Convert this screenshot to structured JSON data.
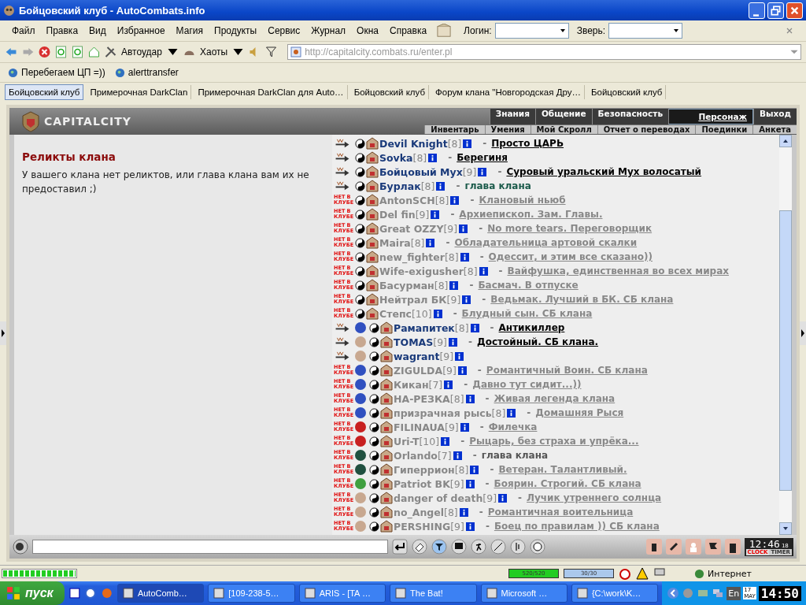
{
  "window": {
    "title": "Бойцовский клуб - AutoCombats.info"
  },
  "menu": [
    "Файл",
    "Правка",
    "Вид",
    "Избранное",
    "Магия",
    "Продукты",
    "Сервис",
    "Журнал",
    "Окна",
    "Справка"
  ],
  "login": {
    "label": "Логин:"
  },
  "pet": {
    "label": "Зверь:"
  },
  "toolbar": {
    "autohit": "Автоудар",
    "chaos": "Хаоты",
    "address": "http://capitalcity.combats.ru/enter.pl"
  },
  "links": [
    "Перебегаем ЦП =))",
    "alerttransfer"
  ],
  "tabs": [
    {
      "label": "Бойцовский клуб",
      "selected": true
    },
    {
      "label": "Примерочная DarkClan",
      "selected": false
    },
    {
      "label": "Примерочная DarkClan для Auto…",
      "selected": false
    },
    {
      "label": "Бойцовский клуб",
      "selected": false
    },
    {
      "label": "Форум клана \"Новгородская Дру…",
      "selected": false
    },
    {
      "label": "Бойцовский клуб",
      "selected": false
    }
  ],
  "game": {
    "logo": "CAPITALCITY",
    "nav_top": [
      {
        "label": "Знания",
        "selected": false
      },
      {
        "label": "Общение",
        "selected": false
      },
      {
        "label": "Безопасность",
        "selected": false
      },
      {
        "label": "Персонаж",
        "selected": true
      },
      {
        "label": "Выход",
        "selected": false
      }
    ],
    "nav_bottom": [
      "Инвентарь",
      "Умения",
      "Мой Скролл",
      "Отчет о переводах",
      "Поединки",
      "Анкета"
    ],
    "relics_heading": "Реликты клана",
    "relics_text": "У вашего клана нет реликтов, или глава клана вам их не предоставил ;)",
    "separator": "-",
    "members": [
      {
        "kind": "in_club",
        "name": "Devil Knight",
        "rank": "[8]",
        "online": true,
        "title": {
          "kind": "link",
          "text": "Просто ЦАРЬ"
        }
      },
      {
        "kind": "in_club",
        "name": "Sovka",
        "rank": "[8]",
        "online": true,
        "title": {
          "kind": "link",
          "text": "Берегиня"
        }
      },
      {
        "kind": "in_club",
        "name": "Бойцовый Мух",
        "rank": "[9]",
        "online": true,
        "title": {
          "kind": "link",
          "text": "Суровый уральский Мух волосатый"
        }
      },
      {
        "kind": "in_club",
        "name": "Бурлак",
        "rank": "[8]",
        "online": true,
        "title": {
          "kind": "plain",
          "text": "глава клана"
        }
      },
      {
        "kind": "not_in_club",
        "badge": "НЕТ В КЛУБЕ",
        "name": "AntonSCH",
        "rank": "[8]",
        "online": false,
        "title": {
          "kind": "link",
          "text": "Клановый ньюб"
        }
      },
      {
        "kind": "not_in_club",
        "badge": "НЕТ В КЛУБЕ",
        "name": "Del fin",
        "rank": "[9]",
        "online": false,
        "title": {
          "kind": "link",
          "text": "Архиепископ. Зам. Главы."
        }
      },
      {
        "kind": "not_in_club",
        "badge": "НЕТ В КЛУБЕ",
        "name": "Great OZZY",
        "rank": "[9]",
        "online": false,
        "title": {
          "kind": "link",
          "text": "No more tears. Переговорщик"
        }
      },
      {
        "kind": "not_in_club",
        "badge": "НЕТ В КЛУБЕ",
        "name": "Maira",
        "rank": "[8]",
        "online": false,
        "title": {
          "kind": "link",
          "text": "Обладательница артовой скалки"
        }
      },
      {
        "kind": "not_in_club",
        "badge": "НЕТ В КЛУБЕ",
        "name": "new_fighter",
        "rank": "[8]",
        "online": false,
        "title": {
          "kind": "link",
          "text": "Одессит, и этим все сказано))"
        }
      },
      {
        "kind": "not_in_club",
        "badge": "НЕТ В КЛУБЕ",
        "name": "Wife-exigusher",
        "rank": "[8]",
        "online": false,
        "title": {
          "kind": "link",
          "text": "Вайфушка, единственная во всех мирах"
        }
      },
      {
        "kind": "not_in_club",
        "badge": "НЕТ В КЛУБЕ",
        "name": "Басурман",
        "rank": "[8]",
        "online": false,
        "title": {
          "kind": "link",
          "text": "Басмач. В отпуске"
        }
      },
      {
        "kind": "not_in_club",
        "badge": "НЕТ В КЛУБЕ",
        "name": "Нейтрал БК",
        "rank": "[9]",
        "online": false,
        "title": {
          "kind": "link",
          "text": "Ведьмак. Лучший в БК. СБ клана"
        }
      },
      {
        "kind": "not_in_club",
        "badge": "НЕТ В КЛУБЕ",
        "name": "Степс",
        "rank": "[10]",
        "online": false,
        "title": {
          "kind": "link",
          "text": "Блудный сын. СБ клана"
        }
      },
      {
        "kind": "in_club",
        "color": "#3050c0",
        "name": "Рамапитек",
        "rank": "[8]",
        "online": true,
        "title": {
          "kind": "link",
          "text": "Антикиллер"
        }
      },
      {
        "kind": "in_club",
        "color": "#c8a890",
        "name": "TOMAS",
        "rank": "[9]",
        "online": true,
        "title": {
          "kind": "link",
          "text": "Достойный. СБ клана."
        }
      },
      {
        "kind": "in_club",
        "color": "#c8a890",
        "name": "wagrant",
        "rank": "[9]",
        "online": true
      },
      {
        "kind": "not_in_club",
        "badge": "НЕТ В КЛУБЕ",
        "color": "#3050c0",
        "name": "ZIGULDA",
        "rank": "[9]",
        "online": false,
        "title": {
          "kind": "link",
          "text": "Романтичный Воин. СБ клана"
        }
      },
      {
        "kind": "not_in_club",
        "badge": "НЕТ В КЛУБЕ",
        "color": "#3050c0",
        "name": "Кикан",
        "rank": "[7]",
        "online": false,
        "title": {
          "kind": "link",
          "text": "Давно тут сидит...))"
        }
      },
      {
        "kind": "not_in_club",
        "badge": "НЕТ В КЛУБЕ",
        "color": "#3050c0",
        "name": "НА-РЕЗКА",
        "rank": "[8]",
        "online": false,
        "title": {
          "kind": "link",
          "text": "Живая легенда клана"
        }
      },
      {
        "kind": "not_in_club",
        "badge": "НЕТ В КЛУБЕ",
        "color": "#3050c0",
        "name": "призрачная рысь",
        "rank": "[8]",
        "online": false,
        "title": {
          "kind": "link",
          "text": "Домашняя Рыся"
        }
      },
      {
        "kind": "not_in_club",
        "badge": "НЕТ В КЛУБЕ",
        "color": "#c82020",
        "name": "FILINAUA",
        "rank": "[9]",
        "online": false,
        "title": {
          "kind": "link",
          "text": "Филечка"
        }
      },
      {
        "kind": "not_in_club",
        "badge": "НЕТ В КЛУБЕ",
        "color": "#c82020",
        "name": "Uri-T",
        "rank": "[10]",
        "online": false,
        "title": {
          "kind": "link",
          "text": "Рыцарь, без страха и упрёка..."
        }
      },
      {
        "kind": "not_in_club",
        "badge": "НЕТ В КЛУБЕ",
        "color": "#205040",
        "name": "Orlando",
        "rank": "[7]",
        "online": false,
        "title": {
          "kind": "plain",
          "text": "глава клана"
        }
      },
      {
        "kind": "not_in_club",
        "badge": "НЕТ В КЛУБЕ",
        "color": "#205040",
        "name": "Гиперрион",
        "rank": "[8]",
        "online": false,
        "title": {
          "kind": "link",
          "text": "Ветеран. Талантливый."
        }
      },
      {
        "kind": "not_in_club",
        "badge": "НЕТ В КЛУБЕ",
        "color": "#40a040",
        "name": "Patriot BK",
        "rank": "[9]",
        "online": false,
        "title": {
          "kind": "link",
          "text": "Боярин. Строгий. СБ клана"
        }
      },
      {
        "kind": "not_in_club",
        "badge": "НЕТ В КЛУБЕ",
        "color": "#c8a890",
        "name": "danger of death",
        "rank": "[9]",
        "online": false,
        "title": {
          "kind": "link",
          "text": "Лучик утреннего солнца"
        }
      },
      {
        "kind": "not_in_club",
        "badge": "НЕТ В КЛУБЕ",
        "color": "#c8a890",
        "name": "no_Angel",
        "rank": "[8]",
        "online": false,
        "title": {
          "kind": "link",
          "text": "Романтичная воительница"
        }
      },
      {
        "kind": "not_in_club",
        "badge": "НЕТ В КЛУБЕ",
        "color": "#c8a890",
        "name": "PERSHING",
        "rank": "[9]",
        "online": false,
        "title": {
          "kind": "link",
          "text": "Боец по правилам )) СБ клана"
        }
      }
    ],
    "clock": {
      "time": "12:46",
      "seconds": "18",
      "tabs": [
        {
          "label": "CLOCK",
          "selected": true
        },
        {
          "label": "TIMER",
          "selected": false
        }
      ]
    }
  },
  "status_bar": {
    "load_bar": {
      "level": 1
    },
    "hp": {
      "reading": "520/520",
      "level": 1
    },
    "mana": {
      "reading": "30/30",
      "level": 1
    },
    "zone": "Интернет"
  },
  "taskbar": {
    "start": "пуск",
    "tasks": [
      {
        "label": "AutoComb…",
        "selected": true
      },
      {
        "label": "[109-238-5…",
        "selected": false
      },
      {
        "label": "ARIS - [TA …",
        "selected": false
      },
      {
        "label": "The Bat!",
        "selected": false
      },
      {
        "label": "Microsoft …",
        "selected": false
      },
      {
        "label": "{C:\\work\\K…",
        "selected": false
      }
    ],
    "lang": "En",
    "date_day": "17",
    "date_month": "MAY",
    "time": "14:50"
  }
}
